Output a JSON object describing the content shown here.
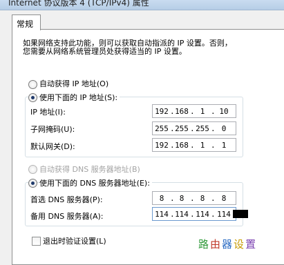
{
  "window": {
    "title": "Internet 协议版本 4 (TCP/IPv4) 属性"
  },
  "tabs": [
    {
      "label": "常规",
      "active": true
    }
  ],
  "description": {
    "line1": "如果网络支持此功能，则可以获取自动指派的 IP 设置。否则，",
    "line2": "您需要从网络系统管理员处获得适当的 IP 设置。"
  },
  "ip_mode": {
    "auto_label": "自动获得 IP 地址(O)",
    "manual_label": "使用下面的 IP 地址(S):",
    "selected": "manual"
  },
  "ip_fields": [
    {
      "label": "IP 地址(I):",
      "octets": [
        "192",
        "168",
        "1",
        "10"
      ]
    },
    {
      "label": "子网掩码(U):",
      "octets": [
        "255",
        "255",
        "255",
        "0"
      ]
    },
    {
      "label": "默认网关(D):",
      "octets": [
        "192",
        "168",
        "1",
        "1"
      ]
    }
  ],
  "dns_mode": {
    "auto_label": "自动获得 DNS 服务器地址(B)",
    "auto_disabled": true,
    "manual_label": "使用下面的 DNS 服务器地址(E):",
    "selected": "manual"
  },
  "dns_fields": [
    {
      "label": "首选 DNS 服务器(P):",
      "octets": [
        "8",
        "8",
        "8",
        "8"
      ]
    },
    {
      "label": "备用 DNS 服务器(A):",
      "octets": [
        "114",
        "114",
        "114",
        "114"
      ]
    }
  ],
  "validate_on_exit": {
    "label": "退出时验证设置(L)",
    "checked": false
  },
  "watermark": {
    "chars": [
      "路",
      "由",
      "器",
      "设",
      "置"
    ],
    "colors": [
      "#2f9a3a",
      "#c0392b",
      "#2b6cc4",
      "#c79a00",
      "#7a3fb0"
    ]
  }
}
